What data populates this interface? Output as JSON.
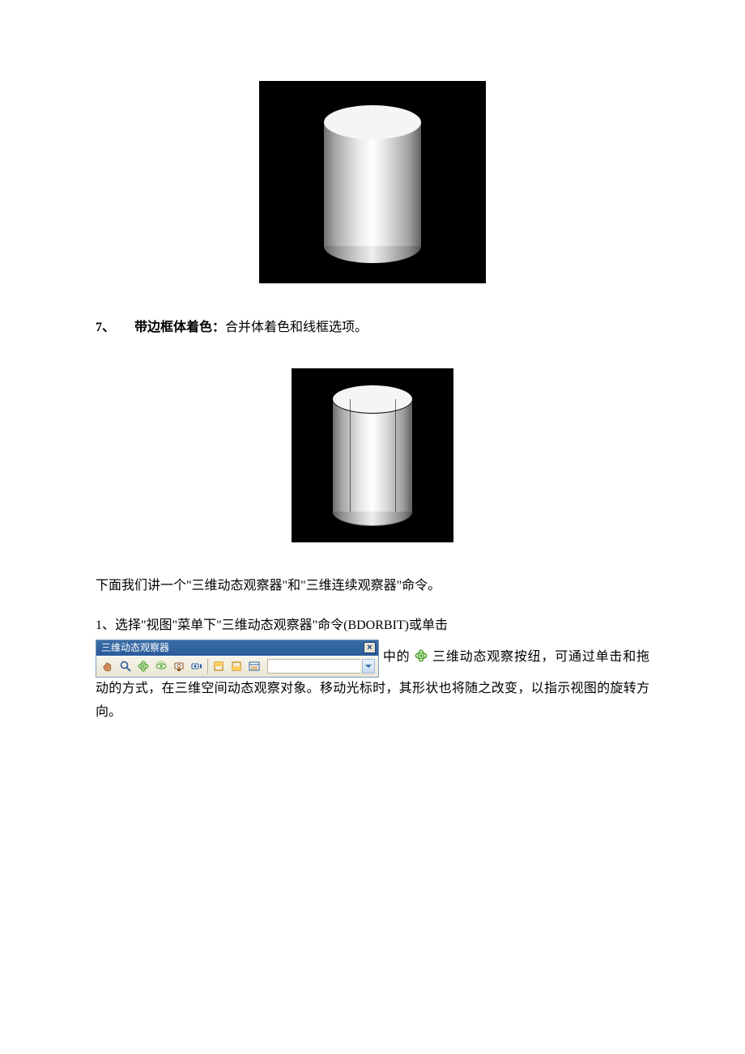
{
  "section7": {
    "number": "7、",
    "label": "带边框体着色：",
    "desc": "合并体着色和线框选项。"
  },
  "paragraph_intro": "下面我们讲一个\"三维动态观察器\"和\"三维连续观察器\"命令。",
  "item1": {
    "prefix": "1、选择\"视图\"菜单下\"三维动态观察器\"命令(BDORBIT)或单击",
    "mid": "中的",
    "after_icon": "三维动态观察按纽，可通过单击和拖动的方式，在三维空间动态观察对象。移动光标时，其形状也将随之改变，以指示视图的旋转方向。"
  },
  "toolbar": {
    "title": "三维动态观察器",
    "icons": [
      "pan-hand",
      "zoom-realtime",
      "orbit",
      "continuous-orbit",
      "swivel",
      "adjust-distance",
      "front-clip",
      "back-clip",
      "options"
    ]
  },
  "orbit_icon_name": "orbit-icon"
}
